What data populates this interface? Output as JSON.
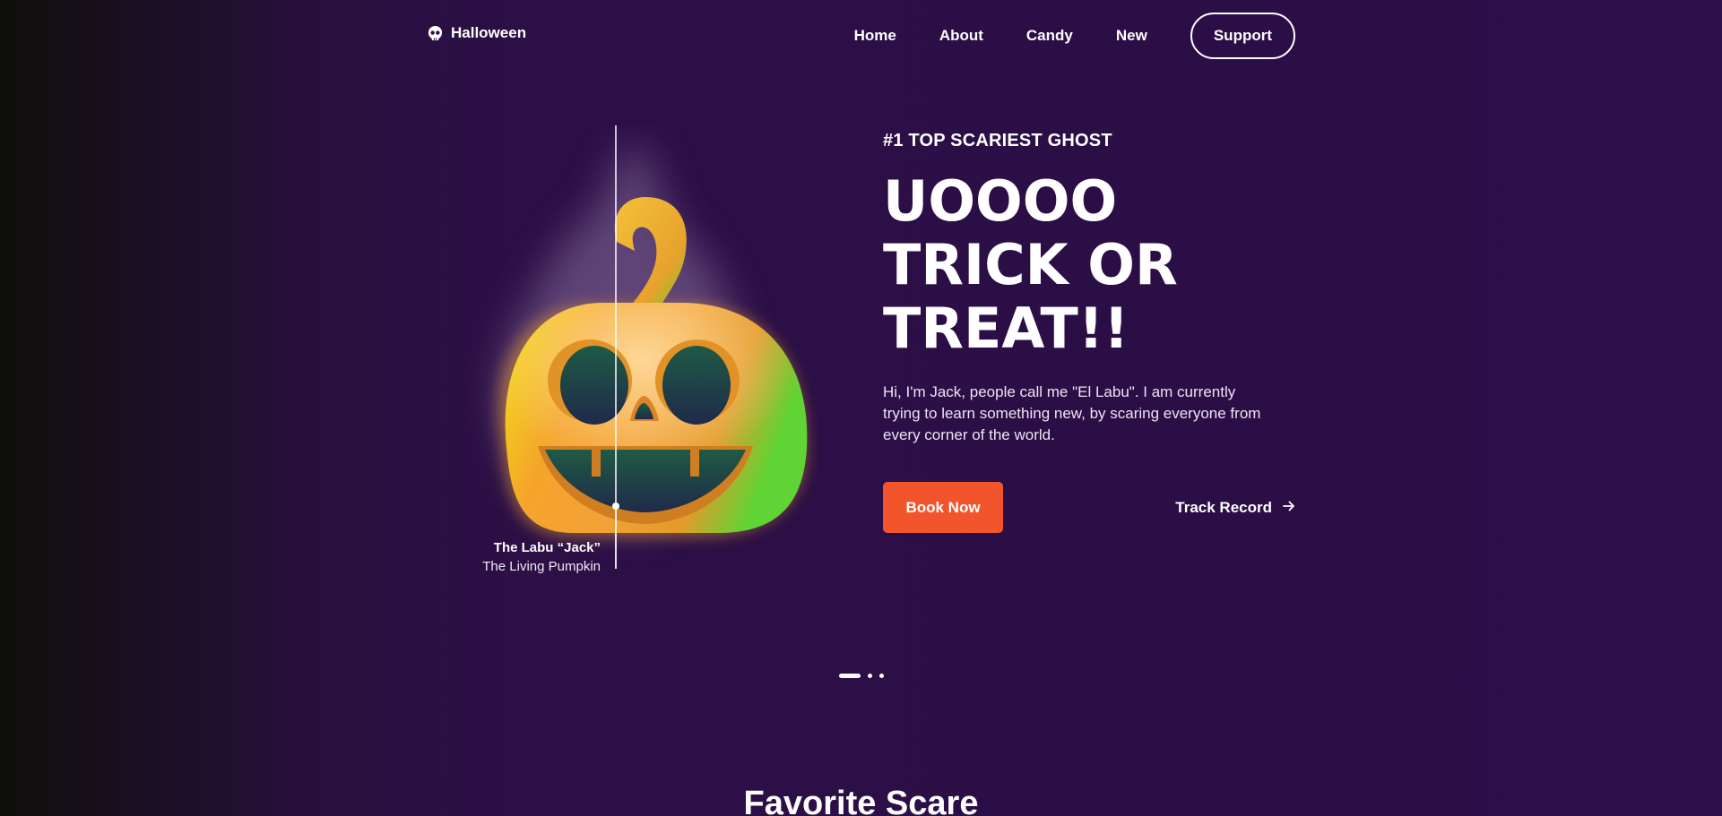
{
  "brand": {
    "name": "Halloween",
    "icon": "skull-icon"
  },
  "nav": {
    "links": [
      "Home",
      "About",
      "Candy",
      "New"
    ],
    "support_label": "Support"
  },
  "hero": {
    "kicker": "#1 TOP SCARIEST GHOST",
    "headline": [
      "UOOOO",
      "TRICK OR",
      "TREAT!!"
    ],
    "description": "Hi, I'm Jack, people call me \"El Labu\". I am currently trying to learn something new, by scaring everyone from every corner of the world.",
    "book_label": "Book Now",
    "track_label": "Track Record",
    "caption_title": "The Labu “Jack”",
    "caption_sub": "The Living Pumpkin",
    "illustration": "jack-o-lantern-pumpkin"
  },
  "carousel": {
    "slides": 3,
    "active": 1
  },
  "section": {
    "title": "Favorite Scare"
  },
  "colors": {
    "background": "#2b0f45",
    "accent": "#f2552c",
    "text": "#ffffff"
  }
}
